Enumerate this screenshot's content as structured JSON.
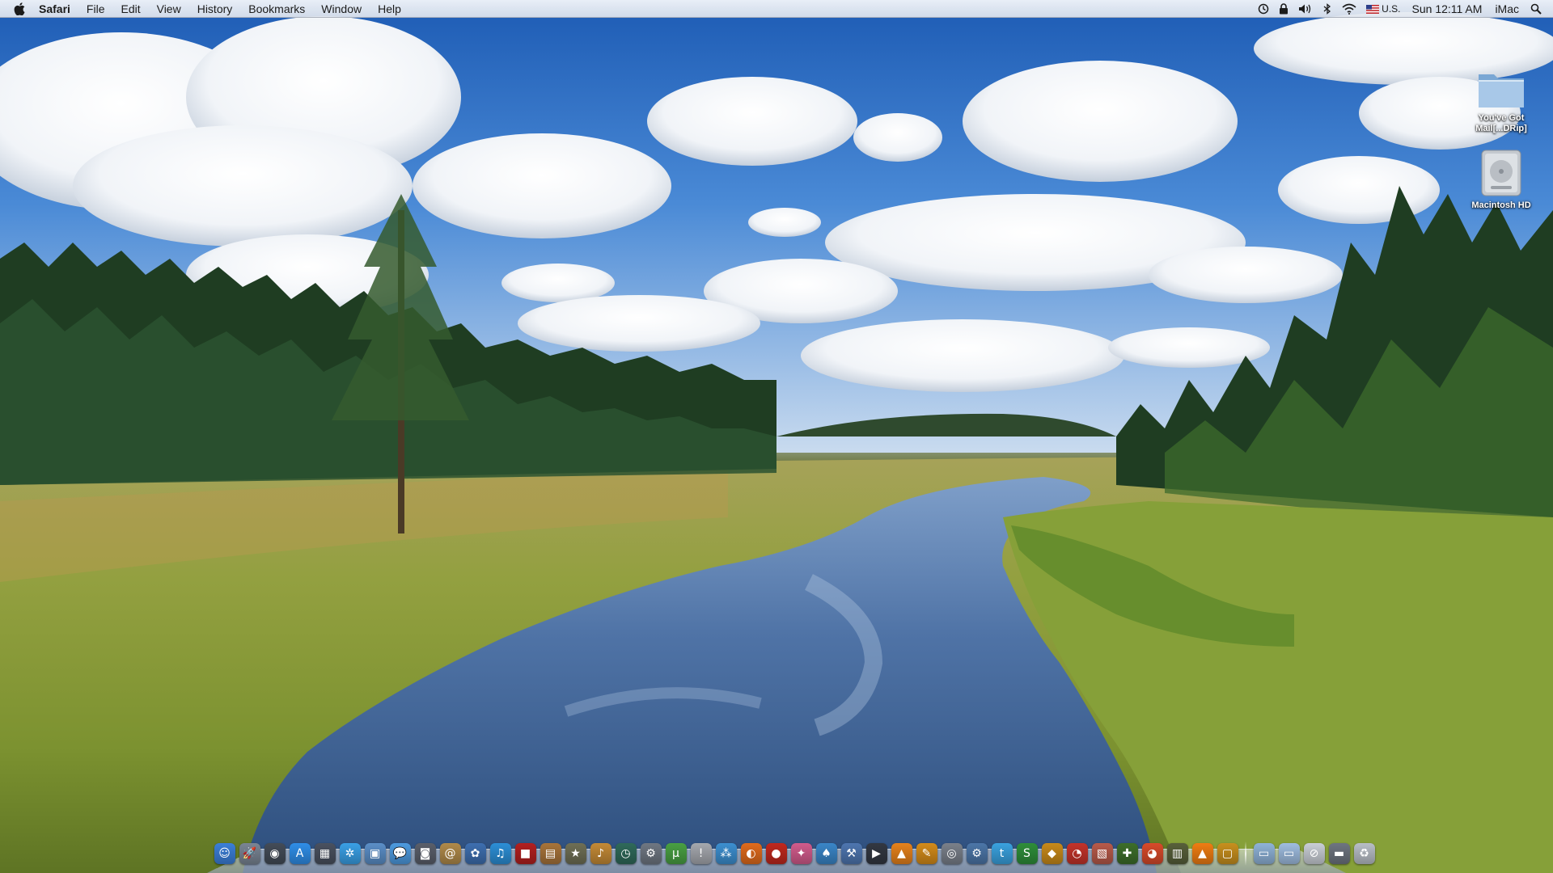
{
  "menubar": {
    "apple_icon": "apple-icon",
    "app_name": "Safari",
    "menus": [
      "File",
      "Edit",
      "View",
      "History",
      "Bookmarks",
      "Window",
      "Help"
    ],
    "status_icons": [
      "time-machine-icon",
      "lock-icon",
      "volume-icon",
      "bluetooth-icon",
      "wifi-icon"
    ],
    "input_source": "U.S.",
    "clock": "Sun 12:11 AM",
    "user": "iMac",
    "spotlight_icon": "spotlight-icon"
  },
  "desktop": {
    "icons": [
      {
        "label": "You've Got Mail[...DRip]",
        "icon": "folder-icon"
      },
      {
        "label": "Macintosh HD",
        "icon": "hard-drive-icon"
      }
    ]
  },
  "dock": {
    "apps": [
      {
        "icon": "finder-icon",
        "glyph": "☺",
        "color": "#3b7fd8"
      },
      {
        "icon": "launchpad-icon",
        "glyph": "🚀",
        "color": "#7a8594"
      },
      {
        "icon": "dashboard-icon",
        "glyph": "◉",
        "color": "#444c58"
      },
      {
        "icon": "app-store-icon",
        "glyph": "A",
        "color": "#2f8ee8"
      },
      {
        "icon": "mission-control-icon",
        "glyph": "▦",
        "color": "#4a5160"
      },
      {
        "icon": "safari-icon",
        "glyph": "✲",
        "color": "#3aa0e6"
      },
      {
        "icon": "preview-icon",
        "glyph": "▣",
        "color": "#5b8fc8"
      },
      {
        "icon": "ichat-icon",
        "glyph": "💬",
        "color": "#4d9be0"
      },
      {
        "icon": "facetime-icon",
        "glyph": "◙",
        "color": "#5a5f6b"
      },
      {
        "icon": "contacts-icon",
        "glyph": "@",
        "color": "#b08a4a"
      },
      {
        "icon": "iphoto-icon",
        "glyph": "✿",
        "color": "#3e6fb0"
      },
      {
        "icon": "itunes-icon",
        "glyph": "♫",
        "color": "#2c8fd6"
      },
      {
        "icon": "photo-booth-icon",
        "glyph": "■",
        "color": "#b32020"
      },
      {
        "icon": "photo-icon",
        "glyph": "▤",
        "color": "#a8743a"
      },
      {
        "icon": "star-icon",
        "glyph": "★",
        "color": "#6f6f55"
      },
      {
        "icon": "garageband-icon",
        "glyph": "♪",
        "color": "#c48a36"
      },
      {
        "icon": "time-machine-icon",
        "glyph": "◷",
        "color": "#2f6a5a"
      },
      {
        "icon": "system-preferences-icon",
        "glyph": "⚙",
        "color": "#6f7782"
      },
      {
        "icon": "utorrent-icon",
        "glyph": "µ",
        "color": "#49a043"
      },
      {
        "icon": "notes-icon",
        "glyph": "!",
        "color": "#a5a8ae"
      },
      {
        "icon": "network-icon",
        "glyph": "⁂",
        "color": "#3c8fd0"
      },
      {
        "icon": "firefox-icon",
        "glyph": "◐",
        "color": "#e06b1c"
      },
      {
        "icon": "ladybug-icon",
        "glyph": "●",
        "color": "#c0281e"
      },
      {
        "icon": "comic-icon",
        "glyph": "✦",
        "color": "#d25b8c"
      },
      {
        "icon": "games-icon",
        "glyph": "♠",
        "color": "#3a86c8"
      },
      {
        "icon": "xcode-icon",
        "glyph": "⚒",
        "color": "#4e76b0"
      },
      {
        "icon": "terminal-icon",
        "glyph": "▶",
        "color": "#333842"
      },
      {
        "icon": "vlc-icon",
        "glyph": "▲",
        "color": "#e6821c"
      },
      {
        "icon": "paint-icon",
        "glyph": "✎",
        "color": "#d38b1a"
      },
      {
        "icon": "disk-utility-icon",
        "glyph": "◎",
        "color": "#7a808a"
      },
      {
        "icon": "tools-icon",
        "glyph": "⚙",
        "color": "#4c76a8"
      },
      {
        "icon": "twitter-icon",
        "glyph": "t",
        "color": "#3aa2df"
      },
      {
        "icon": "skype-icon",
        "glyph": "S",
        "color": "#2e8e3a"
      },
      {
        "icon": "cheese-icon",
        "glyph": "◆",
        "color": "#c88a1a"
      },
      {
        "icon": "clock-icon",
        "glyph": "◔",
        "color": "#c4332a"
      },
      {
        "icon": "photo-editor-icon",
        "glyph": "▧",
        "color": "#b85a4a"
      },
      {
        "icon": "game-controller-icon",
        "glyph": "✚",
        "color": "#3d6e2a"
      },
      {
        "icon": "chrome-icon",
        "glyph": "◕",
        "color": "#d84a2a"
      },
      {
        "icon": "calendar-icon",
        "glyph": "▥",
        "color": "#58603a"
      },
      {
        "icon": "vlc-player-icon",
        "glyph": "▲",
        "color": "#ef7d12"
      },
      {
        "icon": "frame-icon",
        "glyph": "▢",
        "color": "#c8901e"
      }
    ],
    "stacks": [
      {
        "icon": "applications-folder-icon",
        "glyph": "▭",
        "color": "#8fb3d8"
      },
      {
        "icon": "documents-folder-icon",
        "glyph": "▭",
        "color": "#9fbde0"
      },
      {
        "icon": "downloads-stack-icon",
        "glyph": "⊘",
        "color": "#c9ced6"
      },
      {
        "icon": "screen-stack-icon",
        "glyph": "▬",
        "color": "#6e7580"
      },
      {
        "icon": "trash-icon",
        "glyph": "♻",
        "color": "#b8bec6"
      }
    ]
  }
}
